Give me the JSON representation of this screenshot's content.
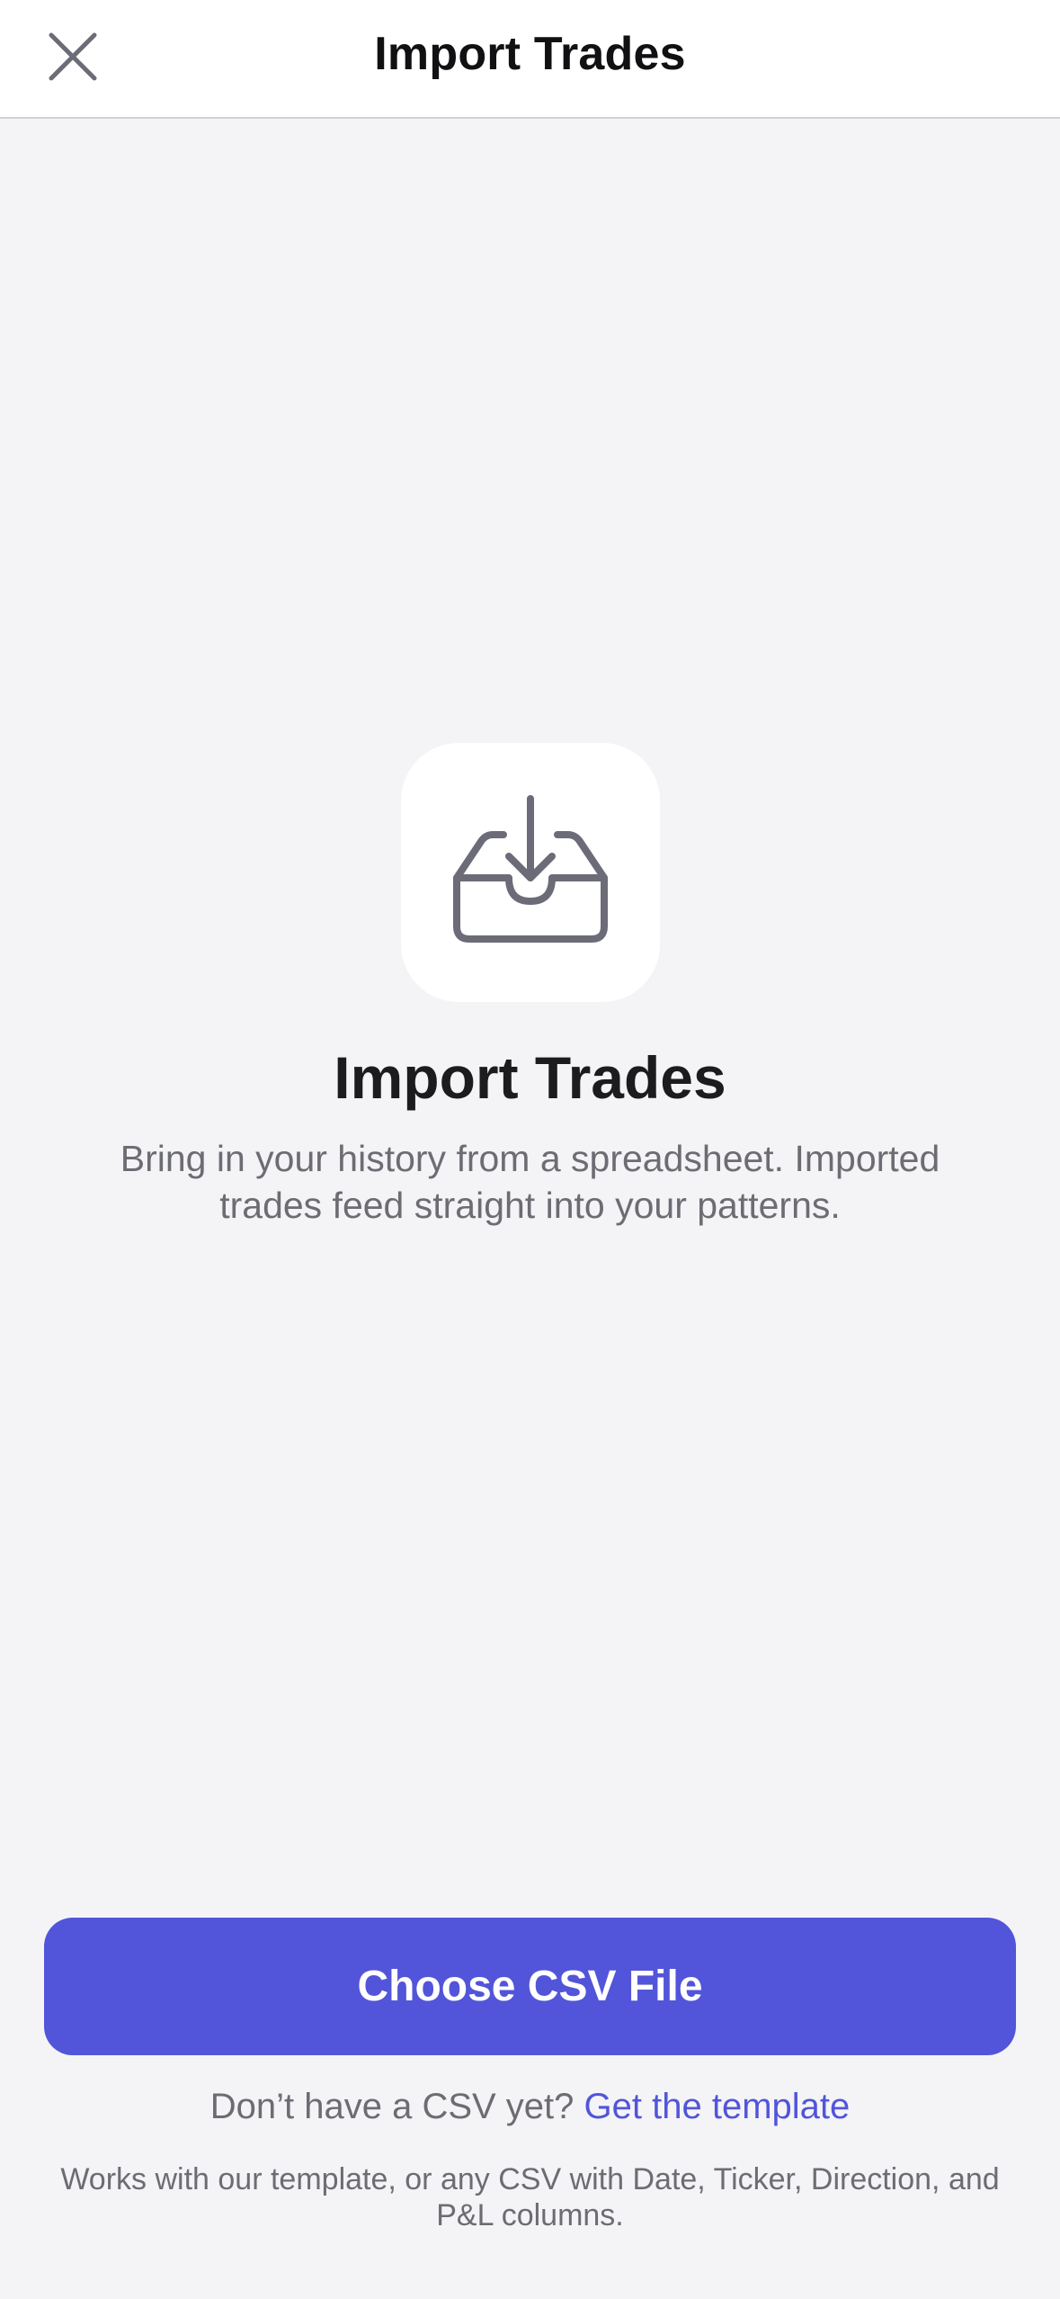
{
  "header": {
    "title": "Import Trades",
    "close_icon": "close-icon"
  },
  "hero": {
    "icon": "tray-download-icon",
    "title": "Import Trades",
    "subtitle": "Bring in your history from a spreadsheet. Imported trades feed straight into your patterns."
  },
  "actions": {
    "primary_label": "Choose CSV File",
    "template_prompt": "Don’t have a CSV yet?",
    "template_link": "Get the template",
    "footnote": "Works with our template, or any CSV with Date, Ticker, Direction, and P&L columns."
  },
  "colors": {
    "accent": "#5255d9",
    "background": "#f4f4f7",
    "icon_gray": "#6c6c78",
    "secondary_text": "#6c6c73"
  }
}
